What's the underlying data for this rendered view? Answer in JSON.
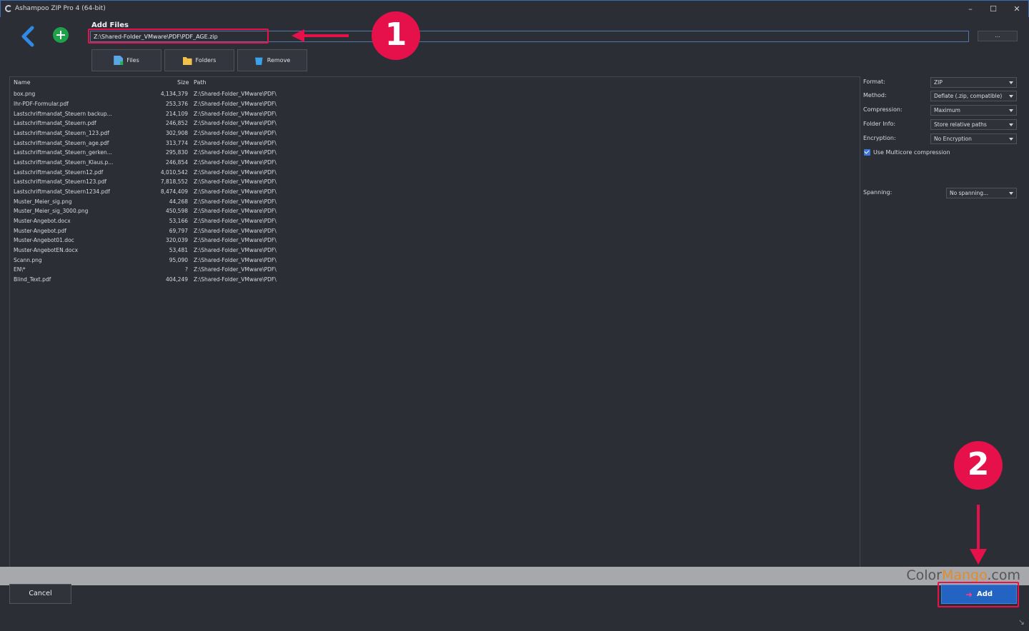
{
  "window": {
    "title": "Ashampoo ZIP Pro 4 (64-bit)",
    "minimize": "–",
    "maximize": "☐",
    "close": "✕"
  },
  "heading": "Add Files",
  "path_value": "Z:\\Shared-Folder_VMware\\PDF\\PDF_AGE.zip",
  "browse_label": "...",
  "toolbar": {
    "files": "Files",
    "folders": "Folders",
    "remove": "Remove"
  },
  "columns": {
    "name": "Name",
    "size": "Size",
    "path": "Path"
  },
  "files": [
    {
      "name": "box.png",
      "size": "4,134,379",
      "path": "Z:\\Shared-Folder_VMware\\PDF\\"
    },
    {
      "name": "Ihr-PDF-Formular.pdf",
      "size": "253,376",
      "path": "Z:\\Shared-Folder_VMware\\PDF\\"
    },
    {
      "name": "Lastschriftmandat_Steuern backup...",
      "size": "214,109",
      "path": "Z:\\Shared-Folder_VMware\\PDF\\"
    },
    {
      "name": "Lastschriftmandat_Steuern.pdf",
      "size": "246,852",
      "path": "Z:\\Shared-Folder_VMware\\PDF\\"
    },
    {
      "name": "Lastschriftmandat_Steuern_123.pdf",
      "size": "302,908",
      "path": "Z:\\Shared-Folder_VMware\\PDF\\"
    },
    {
      "name": "Lastschriftmandat_Steuern_age.pdf",
      "size": "313,774",
      "path": "Z:\\Shared-Folder_VMware\\PDF\\"
    },
    {
      "name": "Lastschriftmandat_Steuern_gerken...",
      "size": "295,830",
      "path": "Z:\\Shared-Folder_VMware\\PDF\\"
    },
    {
      "name": "Lastschriftmandat_Steuern_Klaus.p...",
      "size": "246,854",
      "path": "Z:\\Shared-Folder_VMware\\PDF\\"
    },
    {
      "name": "Lastschriftmandat_Steuern12.pdf",
      "size": "4,010,542",
      "path": "Z:\\Shared-Folder_VMware\\PDF\\"
    },
    {
      "name": "Lastschriftmandat_Steuern123.pdf",
      "size": "7,818,552",
      "path": "Z:\\Shared-Folder_VMware\\PDF\\"
    },
    {
      "name": "Lastschriftmandat_Steuern1234.pdf",
      "size": "8,474,409",
      "path": "Z:\\Shared-Folder_VMware\\PDF\\"
    },
    {
      "name": "Muster_Meier_sig.png",
      "size": "44,268",
      "path": "Z:\\Shared-Folder_VMware\\PDF\\"
    },
    {
      "name": "Muster_Meier_sig_3000.png",
      "size": "450,598",
      "path": "Z:\\Shared-Folder_VMware\\PDF\\"
    },
    {
      "name": "Muster-Angebot.docx",
      "size": "53,166",
      "path": "Z:\\Shared-Folder_VMware\\PDF\\"
    },
    {
      "name": "Muster-Angebot.pdf",
      "size": "69,797",
      "path": "Z:\\Shared-Folder_VMware\\PDF\\"
    },
    {
      "name": "Muster-Angebot01.doc",
      "size": "320,039",
      "path": "Z:\\Shared-Folder_VMware\\PDF\\"
    },
    {
      "name": "Muster-AngebotEN.docx",
      "size": "53,481",
      "path": "Z:\\Shared-Folder_VMware\\PDF\\"
    },
    {
      "name": "Scann.png",
      "size": "95,090",
      "path": "Z:\\Shared-Folder_VMware\\PDF\\"
    },
    {
      "name": "EN\\*",
      "size": "?",
      "path": "Z:\\Shared-Folder_VMware\\PDF\\"
    },
    {
      "name": "Blind_Text.pdf",
      "size": "404,249",
      "path": "Z:\\Shared-Folder_VMware\\PDF\\"
    }
  ],
  "options": {
    "format_label": "Format:",
    "format_value": "ZIP",
    "method_label": "Method:",
    "method_value": "Deflate (.zip, compatible)",
    "compression_label": "Compression:",
    "compression_value": "Maximum",
    "folder_info_label": "Folder Info:",
    "folder_info_value": "Store relative paths",
    "encryption_label": "Encryption:",
    "encryption_value": "No Encryption",
    "multicore_label": "Use Multicore compression",
    "spanning_label": "Spanning:",
    "spanning_value": "No spanning..."
  },
  "buttons": {
    "cancel": "Cancel",
    "add": "Add"
  },
  "watermark": {
    "part1": "Color",
    "part2": "Mango",
    "part3": ".com"
  },
  "annotations": {
    "marker1": "1",
    "marker2": "2",
    "accent": "#e6104a"
  }
}
